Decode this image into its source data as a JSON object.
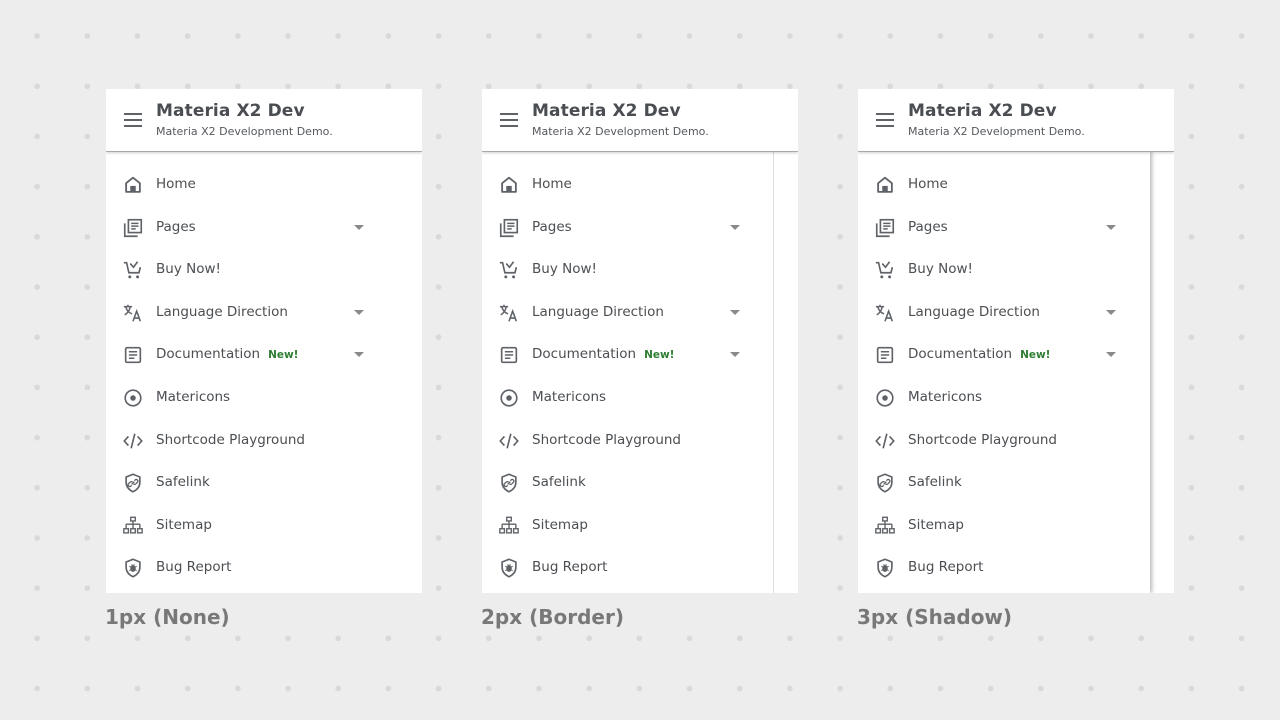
{
  "app": {
    "title": "Materia X2 Dev",
    "subtitle": "Materia X2 Development Demo."
  },
  "nav": [
    {
      "label": "Home",
      "icon": "home-icon",
      "has_submenu": false,
      "badge": ""
    },
    {
      "label": "Pages",
      "icon": "pages-icon",
      "has_submenu": true,
      "badge": ""
    },
    {
      "label": "Buy Now!",
      "icon": "cart-icon",
      "has_submenu": false,
      "badge": ""
    },
    {
      "label": "Language Direction",
      "icon": "translate-icon",
      "has_submenu": true,
      "badge": ""
    },
    {
      "label": "Documentation",
      "icon": "document-icon",
      "has_submenu": true,
      "badge": "New!"
    },
    {
      "label": "Matericons",
      "icon": "radio-button-icon",
      "has_submenu": false,
      "badge": ""
    },
    {
      "label": "Shortcode Playground",
      "icon": "code-icon",
      "has_submenu": false,
      "badge": ""
    },
    {
      "label": "Safelink",
      "icon": "shield-link-icon",
      "has_submenu": false,
      "badge": ""
    },
    {
      "label": "Sitemap",
      "icon": "sitemap-icon",
      "has_submenu": false,
      "badge": ""
    },
    {
      "label": "Bug Report",
      "icon": "shield-bug-icon",
      "has_submenu": false,
      "badge": ""
    }
  ],
  "variants": [
    {
      "caption": "1px (None)",
      "style": "none"
    },
    {
      "caption": "2px (Border)",
      "style": "border"
    },
    {
      "caption": "3px (Shadow)",
      "style": "shadow"
    }
  ],
  "colors": {
    "badge": "#2e7d32",
    "background": "#ededed",
    "text": "#4b4e52"
  }
}
